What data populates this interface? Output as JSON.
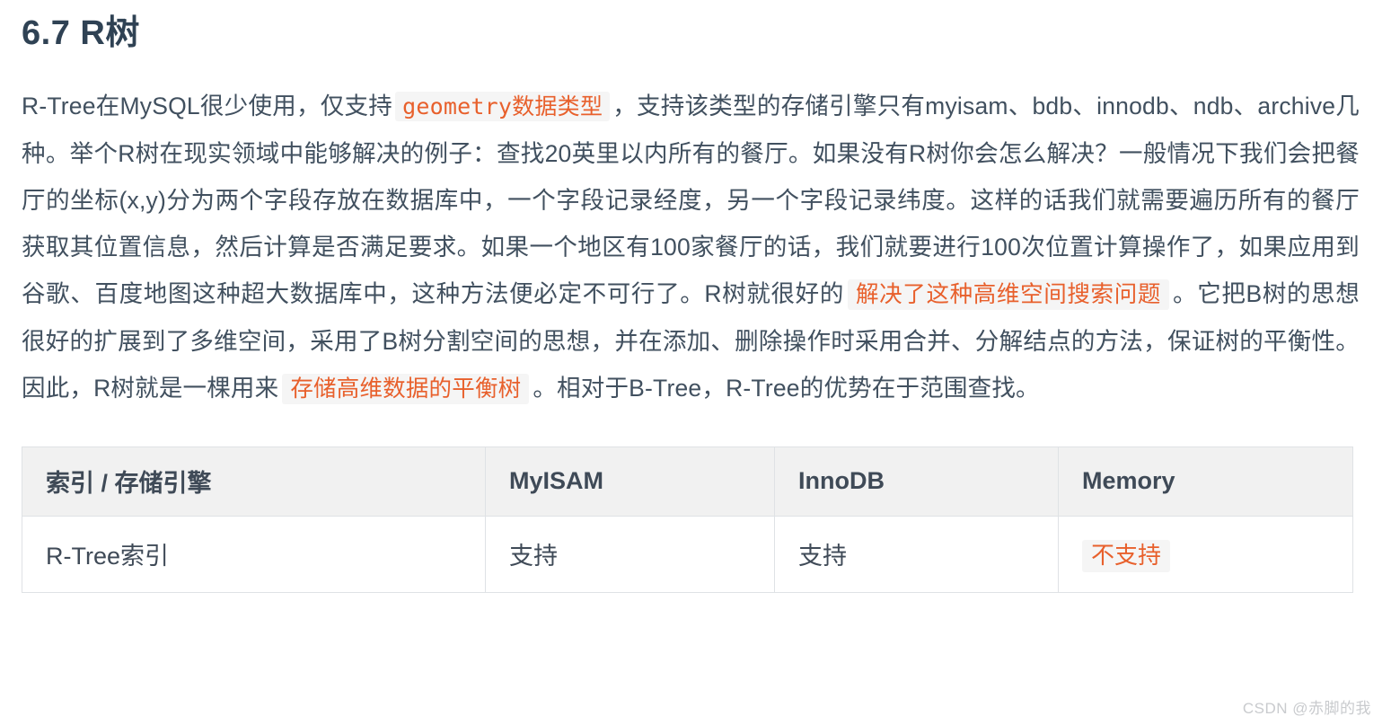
{
  "article": {
    "heading": "6.7 R树",
    "paragraph": {
      "seg1": "R-Tree在MySQL很少使用，仅支持",
      "code1_mono": "geometry",
      "code1_cjk": "数据类型",
      "seg2": "，支持该类型的存储引擎只有myisam、bdb、innodb、ndb、archive几种。举个R树在现实领域中能够解决的例子：查找20英里以内所有的餐厅。如果没有R树你会怎么解决？一般情况下我们会把餐厅的坐标(x,y)分为两个字段存放在数据库中，一个字段记录经度，另一个字段记录纬度。这样的话我们就需要遍历所有的餐厅获取其位置信息，然后计算是否满足要求。如果一个地区有100家餐厅的话，我们就要进行100次位置计算操作了，如果应用到谷歌、百度地图这种超大数据库中，这种方法便必定不可行了。R树就很好的",
      "code2": "解决了这种高维空间搜索问题",
      "seg3": "。它把B树的思想很好的扩展到了多维空间，采用了B树分割空间的思想，并在添加、删除操作时采用合并、分解结点的方法，保证树的平衡性。因此，R树就是一棵用来",
      "code3": "存储高维数据的平衡树",
      "seg4": "。相对于B-Tree，R-Tree的优势在于范围查找。"
    }
  },
  "table": {
    "headers": [
      "索引 / 存储引擎",
      "MyISAM",
      "InnoDB",
      "Memory"
    ],
    "rows": [
      {
        "index_name": "R-Tree索引",
        "myisam": "支持",
        "innodb": "支持",
        "memory": "不支持"
      }
    ]
  },
  "watermark": {
    "text": "CSDN @赤脚的我"
  },
  "colors": {
    "heading": "#2f4254",
    "body_text": "#41505f",
    "accent_orange": "#e8602c",
    "code_background": "#f5f5f5",
    "table_header_background": "#f1f1f1",
    "table_border": "#dfe2e5",
    "watermark": "#c9cbce"
  }
}
